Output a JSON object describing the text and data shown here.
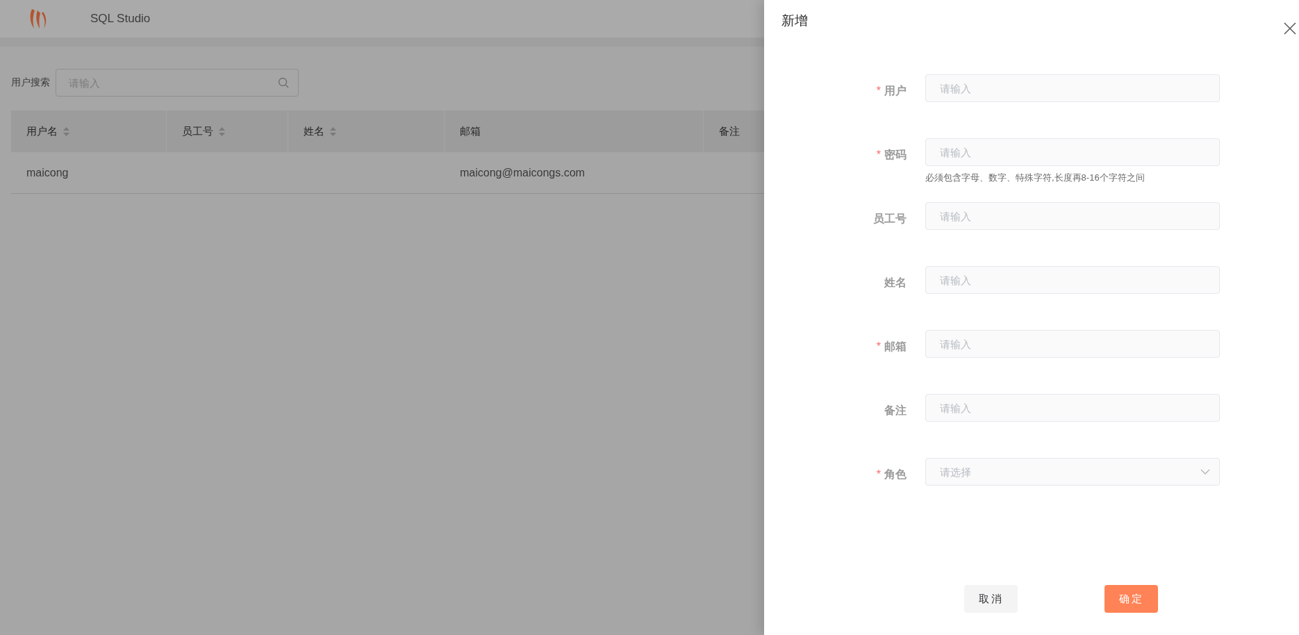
{
  "app": {
    "title": "SQL Studio"
  },
  "search": {
    "label": "用户搜索",
    "placeholder": "请输入"
  },
  "table": {
    "columns": [
      {
        "label": "用户名",
        "sortable": true
      },
      {
        "label": "员工号",
        "sortable": true
      },
      {
        "label": "姓名",
        "sortable": true
      },
      {
        "label": "邮箱",
        "sortable": false
      },
      {
        "label": "备注",
        "sortable": false
      }
    ],
    "rows": [
      {
        "cells": [
          "maicong",
          null,
          null,
          "maicong@maicongs.com",
          null
        ]
      }
    ]
  },
  "drawer": {
    "title": "新增",
    "fields": [
      {
        "label": "用户",
        "required_mark": "*",
        "kind": "input",
        "placeholder": "请输入"
      },
      {
        "label": "密码",
        "required_mark": "*",
        "kind": "input",
        "placeholder": "请输入",
        "help": "必须包含字母、数字、特殊字符,长度再8-16个字符之间"
      },
      {
        "label": "员工号",
        "kind": "input",
        "placeholder": "请输入"
      },
      {
        "label": "姓名",
        "kind": "input",
        "placeholder": "请输入"
      },
      {
        "label": "邮箱",
        "required_mark": "*",
        "kind": "input",
        "placeholder": "请输入"
      },
      {
        "label": "备注",
        "kind": "input",
        "placeholder": "请输入"
      },
      {
        "label": "角色",
        "required_mark": "*",
        "kind": "select",
        "placeholder": "请选择"
      }
    ],
    "buttons": [
      {
        "label": "取消",
        "kind": "secondary"
      },
      {
        "label": "确定",
        "kind": "primary"
      }
    ]
  }
}
